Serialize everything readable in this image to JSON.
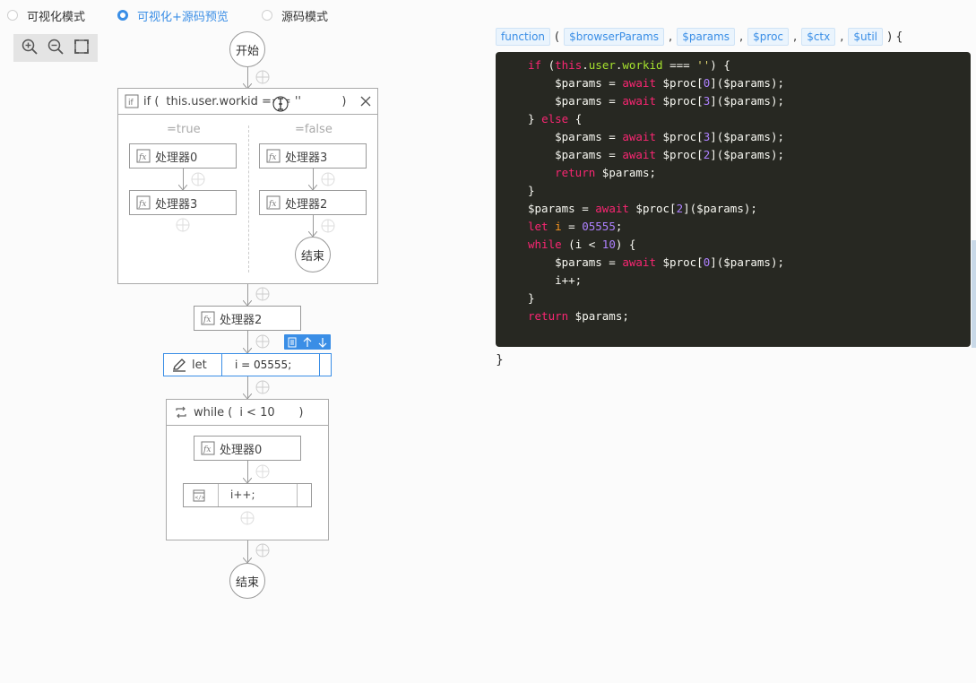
{
  "modes": [
    {
      "label": "可视化模式",
      "active": false
    },
    {
      "label": "可视化+源码预览",
      "active": true
    },
    {
      "label": "源码模式",
      "active": false
    }
  ],
  "toolbar": {
    "icons": [
      "zoom-in-icon",
      "zoom-out-icon",
      "fit-screen-icon"
    ]
  },
  "flow": {
    "start": "开始",
    "if_node": {
      "keyword": "if (",
      "condition": "this.user.workid === ''",
      "close": ")"
    },
    "true_label": "=true",
    "false_label": "=false",
    "true_branch": [
      "处理器0",
      "处理器3"
    ],
    "false_branch": [
      "处理器3",
      "处理器2"
    ],
    "false_end": "结束",
    "after_if": "处理器2",
    "let_node": {
      "keyword": "let",
      "value": "i = 05555;"
    },
    "while_node": {
      "keyword": "while (",
      "condition": "i < 10",
      "close": ")"
    },
    "while_body": [
      "处理器0"
    ],
    "while_stmt": "i++;",
    "end": "结束"
  },
  "code": {
    "keyword": "function",
    "params": [
      "$browserParams",
      "$params",
      "$proc",
      "$ctx",
      "$util"
    ],
    "open": ") {",
    "lparen": "(",
    "close": "}"
  },
  "colors": {
    "accent": "#3a8ee6",
    "code_bg": "#272822",
    "keyword": "#f92672",
    "number": "#ae81ff",
    "string": "#e6db74",
    "prop": "#a6e22e"
  }
}
